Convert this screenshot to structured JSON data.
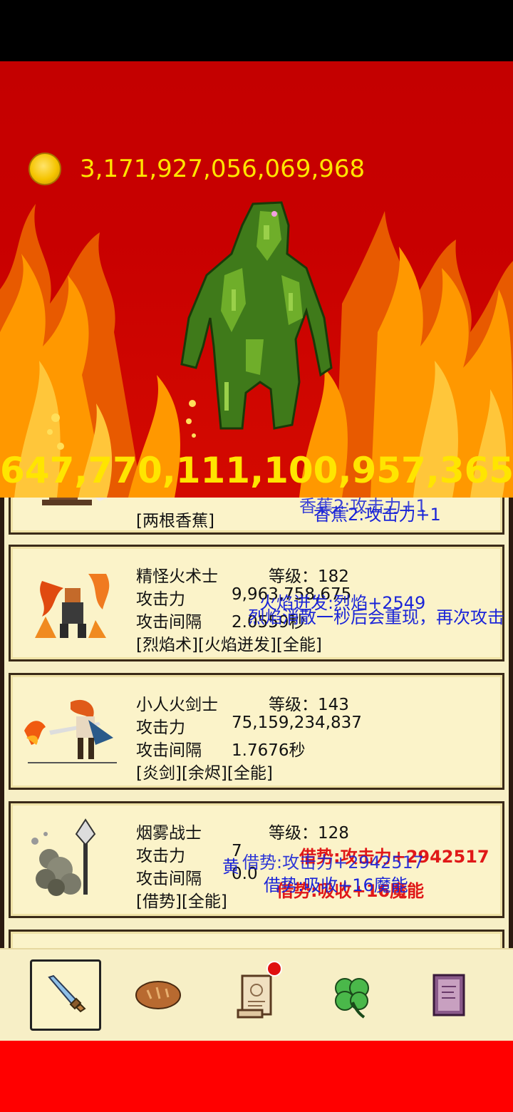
{
  "currency": {
    "icon": "gold-coin-icon",
    "value": "3,171,927,056,069,968"
  },
  "boss": {
    "hp": "647,770,111,100,957,365"
  },
  "heroes": [
    {
      "skills": "[两根香蕉]"
    },
    {
      "name": "精怪火术士",
      "level": "等级：182",
      "attack_label": "攻击力",
      "attack_value": "9,963,758,675",
      "interval_label": "攻击间隔",
      "interval_value": "2.0559秒",
      "skills": "[烈焰术][火焰迸发][全能]"
    },
    {
      "name": "小人火剑士",
      "level": "等级：143",
      "attack_label": "攻击力",
      "attack_value": "75,159,234,837",
      "interval_label": "攻击间隔",
      "interval_value": "1.7676秒",
      "skills": "[炎剑][余烬][全能]"
    },
    {
      "name": "烟雾战士",
      "level": "等级：128",
      "attack_label": "攻击力",
      "attack_value": "7",
      "interval_label": "攻击间隔",
      "interval_value": "0.0",
      "skills": "[借势][全能]"
    }
  ],
  "floating_texts": {
    "banana_1": "香蕉2:攻击力+1",
    "banana_2": "香蕉2:攻击力+1",
    "flame_1": "火焰迸发:烈焰+2549",
    "flame_2": "烈焰消散一秒后会重现，再次攻击",
    "smoke_1": "借势:攻击力+2942517",
    "smoke_2": "借势:吸收+16魔能",
    "smoke_3": "黄"
  },
  "nav": {
    "items": [
      "sword-icon",
      "bread-icon",
      "scroll-icon",
      "clover-icon",
      "book-icon"
    ],
    "active": 0
  },
  "colors": {
    "gold_text": "#ffe500",
    "arena_red": "#c80000",
    "panel_bg": "#f7efc6",
    "float_blue": "#1a24d8",
    "float_red": "#e01818"
  }
}
